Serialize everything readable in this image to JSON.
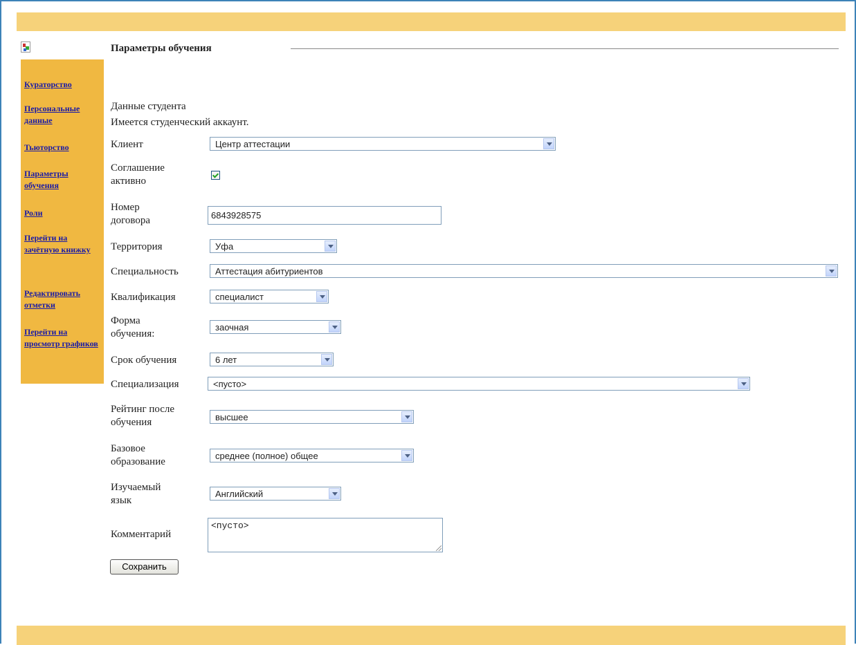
{
  "header": {
    "title": "Параметры обучения"
  },
  "sidebar": {
    "items": [
      {
        "label": "Кураторство"
      },
      {
        "label": "Персональные данные"
      },
      {
        "label": "Тьюторство"
      },
      {
        "label": "Параметры обучения"
      },
      {
        "label": "Роли"
      },
      {
        "label": "Перейти на зачётную книжку"
      },
      {
        "label": "Редактировать отметки"
      },
      {
        "label": "Перейти на просмотр графиков"
      }
    ]
  },
  "info": {
    "student_data": "Данные студента",
    "account_status": "Имеется студенческий аккаунт."
  },
  "form": {
    "client": {
      "label": "Клиент",
      "value": "Центр аттестации"
    },
    "agreement": {
      "label": "Соглашение активно",
      "checked": true
    },
    "contract": {
      "label": "Номер договора",
      "value": "6843928575"
    },
    "territory": {
      "label": "Территория",
      "value": "Уфа"
    },
    "specialty": {
      "label": "Специальность",
      "value": "Аттестация абитуриентов"
    },
    "qualification": {
      "label": "Квалификация",
      "value": "специалист"
    },
    "study_form": {
      "label": "Форма обучения:",
      "value": "заочная"
    },
    "duration": {
      "label": "Срок обучения",
      "value": "6 лет"
    },
    "specialization": {
      "label": "Специализация",
      "value": "<пусто>"
    },
    "rating": {
      "label": "Рейтинг после обучения",
      "value": "высшее"
    },
    "base_education": {
      "label": "Базовое образование",
      "value": "среднее (полное) общее"
    },
    "language": {
      "label": "Изучаемый язык",
      "value": "Английский"
    },
    "comment": {
      "label": "Комментарий",
      "value": "<пусто>"
    },
    "save_label": "Сохранить"
  }
}
